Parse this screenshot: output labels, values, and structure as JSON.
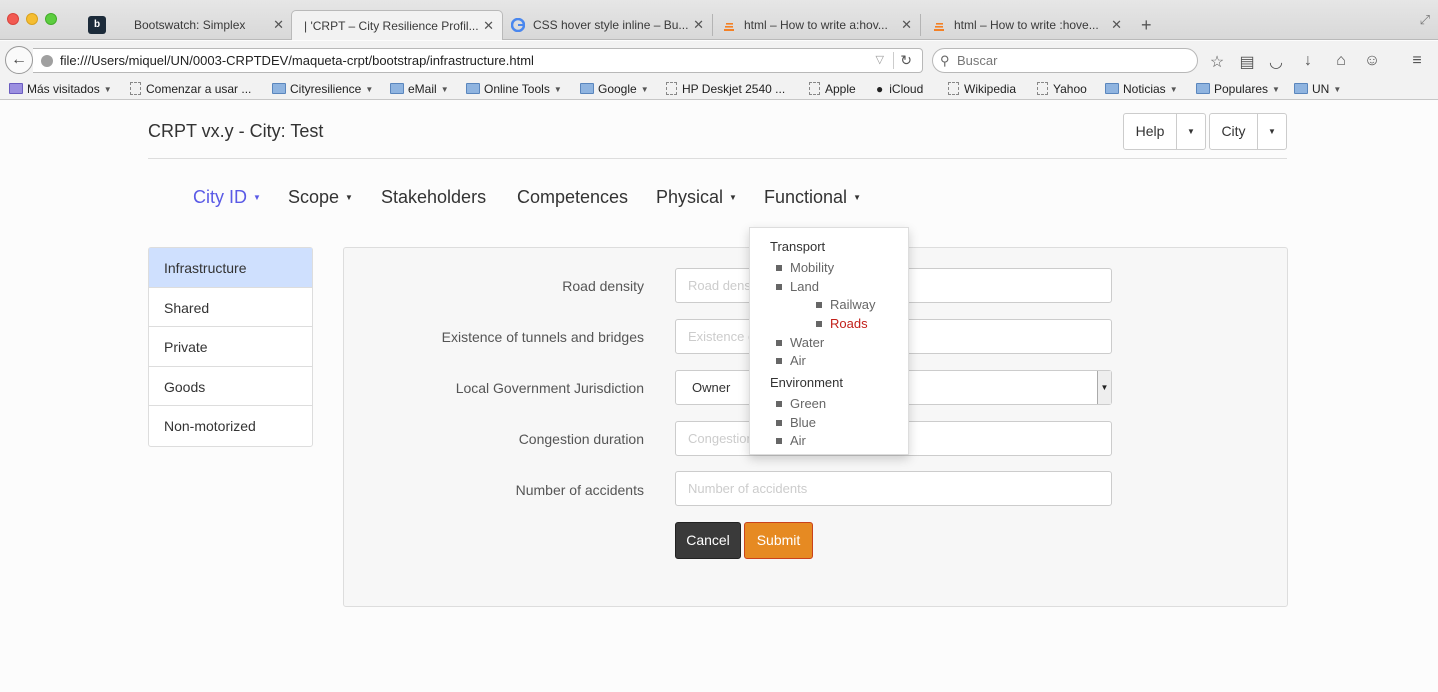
{
  "browser": {
    "tabs": [
      {
        "title": "Bootswatch: Simplex"
      },
      {
        "title": "| 'CRPT – City Resilience Profil..."
      },
      {
        "title": "CSS hover style inline – Bu..."
      },
      {
        "title": "html – How to write a:hov..."
      },
      {
        "title": "html – How to write :hove..."
      }
    ],
    "pinned_tab_label": "b",
    "url": "file:///Users/miquel/UN/0003-CRPTDEV/maqueta-crpt/bootstrap/infrastructure.html",
    "search_placeholder": "Buscar",
    "bookmarks": [
      {
        "label": "Más visitados",
        "kind": "folder"
      },
      {
        "label": "Comenzar a usar ...",
        "kind": "page"
      },
      {
        "label": "Cityresilience",
        "kind": "folder"
      },
      {
        "label": "eMail",
        "kind": "folder"
      },
      {
        "label": "Online Tools",
        "kind": "folder"
      },
      {
        "label": "Google",
        "kind": "folder"
      },
      {
        "label": "HP Deskjet 2540 ...",
        "kind": "page"
      },
      {
        "label": "Apple",
        "kind": "page"
      },
      {
        "label": "iCloud",
        "kind": "apple"
      },
      {
        "label": "Wikipedia",
        "kind": "page"
      },
      {
        "label": "Yahoo",
        "kind": "page"
      },
      {
        "label": "Noticias",
        "kind": "folder"
      },
      {
        "label": "Populares",
        "kind": "folder"
      },
      {
        "label": "UN",
        "kind": "folder"
      }
    ]
  },
  "app": {
    "brand": "CRPT vx.y - City: Test",
    "help_label": "Help",
    "city_label": "City",
    "nav": [
      {
        "label": "City ID"
      },
      {
        "label": "Scope"
      },
      {
        "label": "Stakeholders"
      },
      {
        "label": "Competences"
      },
      {
        "label": "Physical"
      },
      {
        "label": "Functional"
      }
    ],
    "sidebar": [
      {
        "label": "Infrastructure"
      },
      {
        "label": "Shared"
      },
      {
        "label": "Private"
      },
      {
        "label": "Goods"
      },
      {
        "label": "Non-motorized"
      }
    ],
    "form": {
      "fields": [
        {
          "label": "Road density",
          "placeholder": "Road density"
        },
        {
          "label": "Existence of tunnels and bridges",
          "placeholder": "Existence of tunnels and bridges"
        },
        {
          "label": "Local Government Jurisdiction",
          "value": "Owner"
        },
        {
          "label": "Congestion duration",
          "placeholder": "Congestion duration"
        },
        {
          "label": "Number of accidents",
          "placeholder": "Number of accidents"
        }
      ],
      "cancel_label": "Cancel",
      "submit_label": "Submit"
    },
    "dropdown": {
      "transport_header": "Transport",
      "mobility": "Mobility",
      "land": "Land",
      "railway": "Railway",
      "roads": "Roads",
      "water": "Water",
      "air": "Air",
      "environment_header": "Environment",
      "green": "Green",
      "blue": "Blue",
      "air2": "Air"
    }
  },
  "colors": {
    "accent_nav": "#5a5ae6",
    "selected_sidebar": "#cfe0fe",
    "submit": "#e68a22",
    "cancel": "#3a3a3a",
    "active_dropdown_item": "#c2201a"
  }
}
